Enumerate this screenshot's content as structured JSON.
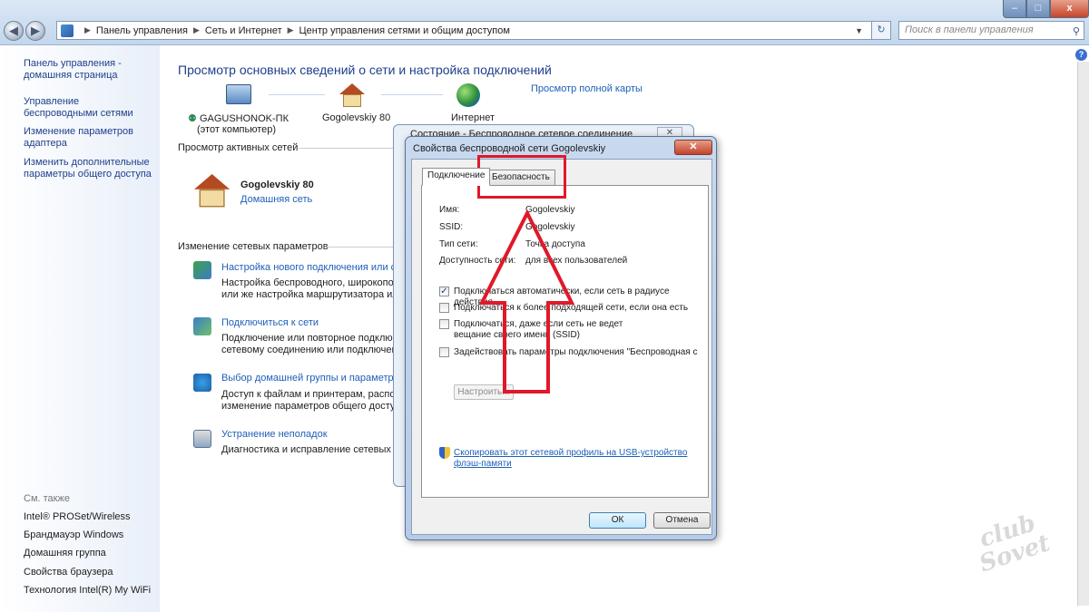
{
  "window_controls": {
    "min": "–",
    "max": "□",
    "close": "x"
  },
  "address": {
    "parts": [
      "Панель управления",
      "Сеть и Интернет",
      "Центр управления сетями и общим доступом"
    ],
    "search_placeholder": "Поиск в панели управления"
  },
  "sidebar": {
    "links": [
      "Панель управления - домашняя страница",
      "Управление беспроводными сетями",
      "Изменение параметров адаптера",
      "Изменить дополнительные параметры общего доступа"
    ],
    "see_also_label": "См. также",
    "see_also": [
      "Intel® PROSet/Wireless",
      "Брандмауэр Windows",
      "Домашняя группа",
      "Свойства браузера",
      "Технология Intel(R) My WiFi"
    ]
  },
  "main": {
    "title": "Просмотр основных сведений о сети и настройка подключений",
    "full_map": "Просмотр полной карты",
    "map": {
      "pc_name": "GAGUSHONOK-ПК",
      "pc_sub": "(этот компьютер)",
      "network": "Gogolevskiy 80",
      "internet": "Интернет"
    },
    "active_label": "Просмотр активных сетей",
    "active_network": {
      "name": "Gogolevskiy 80",
      "type": "Домашняя сеть"
    },
    "change_label": "Изменение сетевых параметров",
    "tasks": [
      {
        "link": "Настройка нового подключения или се",
        "desc1": "Настройка беспроводного, широкопол",
        "desc2": "или же настройка маршрутизатора или"
      },
      {
        "link": "Подключиться к сети",
        "desc1": "Подключение или повторное подключе",
        "desc2": "сетевому соединению или подключени"
      },
      {
        "link": "Выбор домашней группы и параметров",
        "desc1": "Доступ к файлам и принтерам, распол",
        "desc2": "изменение параметров общего доступ"
      },
      {
        "link": "Устранение неполадок",
        "desc1": "Диагностика и исправление сетевых пр",
        "desc2": ""
      }
    ]
  },
  "status_dialog": {
    "title": "Состояние - Беспроводное сетевое соединение"
  },
  "dialog": {
    "title": "Свойства беспроводной сети Gogolevskiy",
    "tabs": [
      "Подключение",
      "Безопасность"
    ],
    "fields": [
      {
        "key": "Имя:",
        "value": "Gogolevskiy"
      },
      {
        "key": "SSID:",
        "value": "Gogolevskiy"
      },
      {
        "key": "Тип сети:",
        "value": "Точка доступа"
      },
      {
        "key": "Доступность сети:",
        "value": "для всех пользователей"
      }
    ],
    "checkboxes": [
      {
        "label": "Подключаться автоматически, если сеть в радиусе действия",
        "checked": true
      },
      {
        "label": "Подключаться к более подходящей сети, если она есть",
        "checked": false
      },
      {
        "label": "Подключаться, даже если сеть не ведет вещание своего имени (SSID)",
        "checked": false
      },
      {
        "label": "Задействовать параметры подключения \"Беспроводная с",
        "checked": false
      }
    ],
    "configure": "Настроить...",
    "copy_link": "Скопировать этот сетевой профиль на USB-устройство флэш-памяти",
    "ok": "ОК",
    "cancel": "Отмена"
  },
  "watermark": "club Sovet",
  "colors": {
    "annotation_red": "#e0182a",
    "link_blue": "#1e5fb8",
    "title_blue": "#1e3f8a"
  }
}
